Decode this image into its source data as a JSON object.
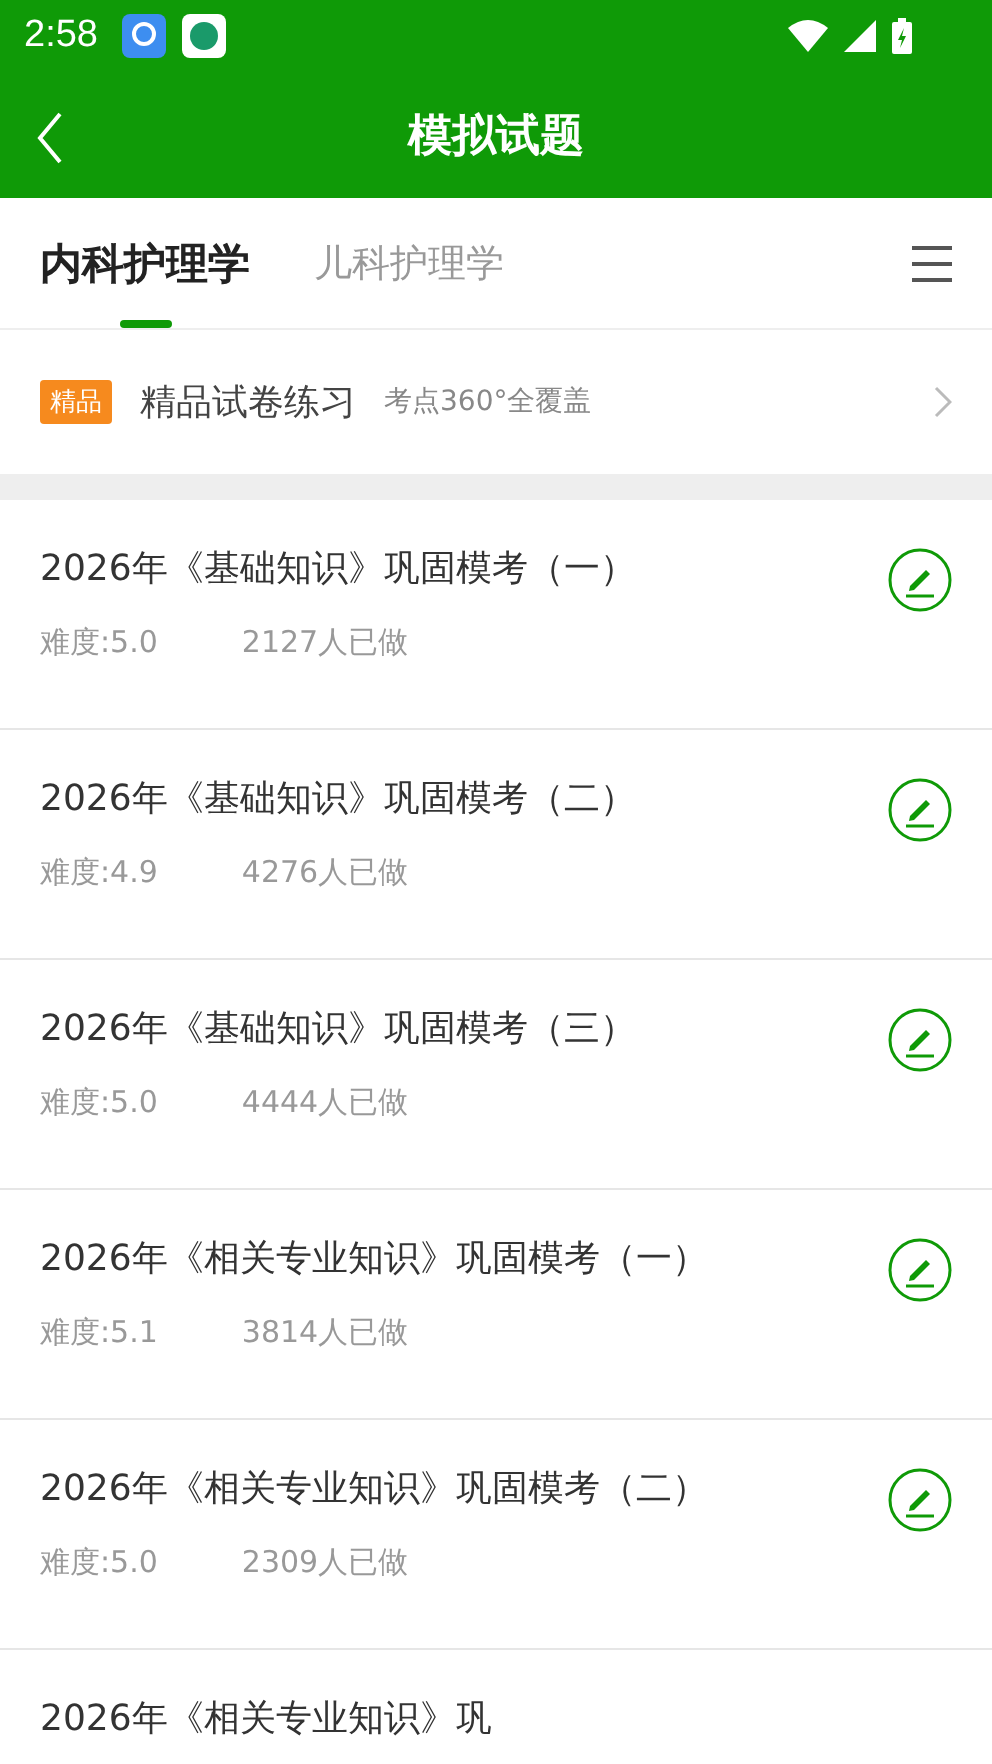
{
  "status_bar": {
    "time": "2:58"
  },
  "header": {
    "title": "模拟试题"
  },
  "tabs": [
    {
      "label": "内科护理学",
      "selected": true
    },
    {
      "label": "儿科护理学",
      "selected": false
    }
  ],
  "promo": {
    "badge": "精品",
    "title": "精品试卷练习",
    "subtitle": "考点360°全覆盖"
  },
  "exams": [
    {
      "title": "2026年《基础知识》巩固模考（一）",
      "difficulty": "难度:5.0",
      "count": "2127人已做"
    },
    {
      "title": "2026年《基础知识》巩固模考（二）",
      "difficulty": "难度:4.9",
      "count": "4276人已做"
    },
    {
      "title": "2026年《基础知识》巩固模考（三）",
      "difficulty": "难度:5.0",
      "count": "4444人已做"
    },
    {
      "title": "2026年《相关专业知识》巩固模考（一）",
      "difficulty": "难度:5.1",
      "count": "3814人已做"
    },
    {
      "title": "2026年《相关专业知识》巩固模考（二）",
      "difficulty": "难度:5.0",
      "count": "2309人已做"
    },
    {
      "title": "2026年《相关专业知识》巩"
    }
  ]
}
